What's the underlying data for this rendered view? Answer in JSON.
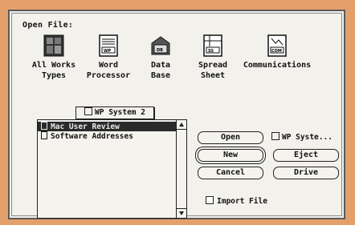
{
  "dialog": {
    "title": "Open File:"
  },
  "file_types": [
    {
      "label": "All Works\nTypes",
      "icon": "all-works-icon"
    },
    {
      "label": "Word\nProcessor",
      "icon": "word-processor-icon"
    },
    {
      "label": "Data\nBase",
      "icon": "database-icon"
    },
    {
      "label": "Spread\nSheet",
      "icon": "spreadsheet-icon"
    },
    {
      "label": "Communications",
      "icon": "communications-icon"
    }
  ],
  "volume_popup": {
    "label": "WP System 2"
  },
  "files": [
    {
      "name": "Mac User Review",
      "selected": true
    },
    {
      "name": "Software Addresses",
      "selected": false
    }
  ],
  "buttons": {
    "open": "Open",
    "new": "New",
    "cancel": "Cancel",
    "eject": "Eject",
    "drive": "Drive"
  },
  "current_disk": "WP Syste...",
  "import_file": {
    "label": "Import File",
    "checked": false
  },
  "colors": {
    "background": "#e4a06a",
    "dialog": "#f3f1ec",
    "selection": "#2a2a2a"
  }
}
